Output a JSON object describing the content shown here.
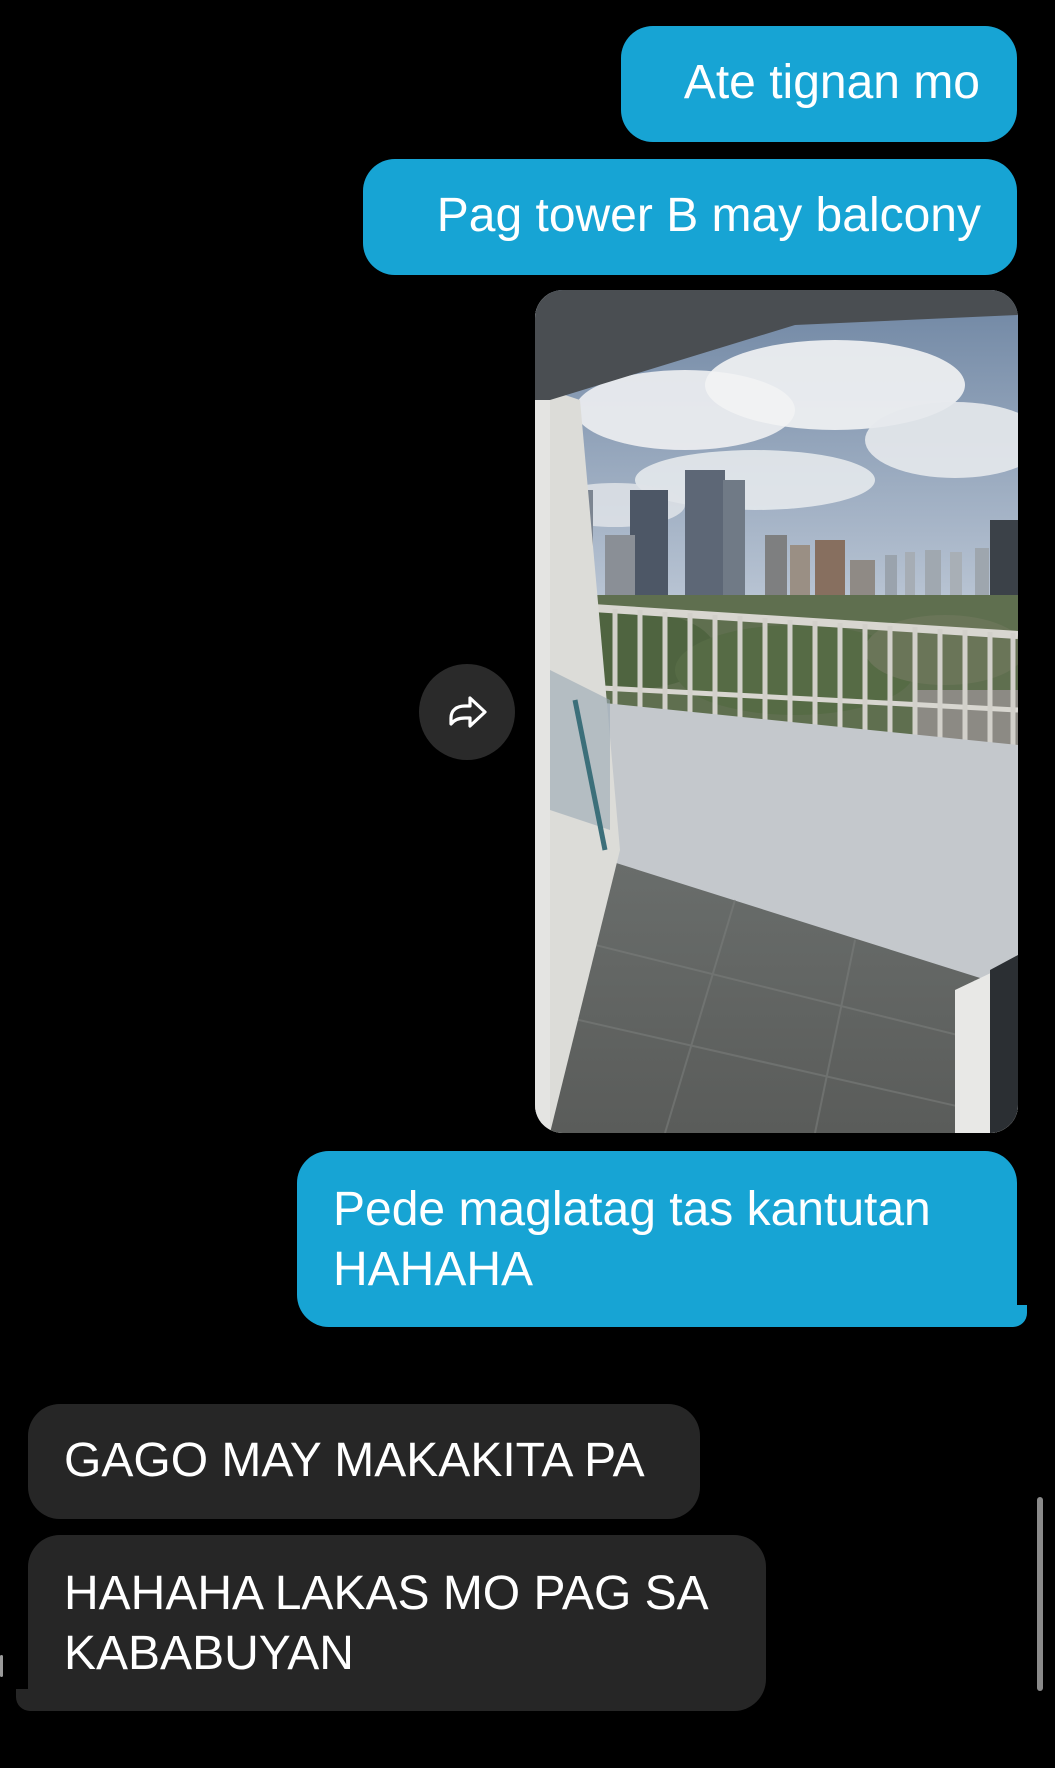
{
  "conversation": {
    "messages": [
      {
        "direction": "outgoing",
        "type": "text",
        "text": "Ate tignan mo"
      },
      {
        "direction": "outgoing",
        "type": "text",
        "text": "Pag tower B may balcony"
      },
      {
        "direction": "outgoing",
        "type": "image",
        "image_icon": "balcony-city-view-photo"
      },
      {
        "direction": "outgoing",
        "type": "text",
        "text": "Pede maglatag tas kantutan HAHAHA"
      },
      {
        "direction": "incoming",
        "type": "text",
        "text": "GAGO MAY MAKAKITA PA"
      },
      {
        "direction": "incoming",
        "type": "text",
        "text": "HAHAHA LAKAS MO PAG SA KABABUYAN"
      }
    ]
  },
  "controls": {
    "share_icon": "share-arrow-icon"
  },
  "colors": {
    "background": "#000000",
    "outgoing_bubble": "#17a4d4",
    "incoming_bubble": "#262626",
    "text": "#ffffff",
    "share_button": "#2a2a2a"
  }
}
